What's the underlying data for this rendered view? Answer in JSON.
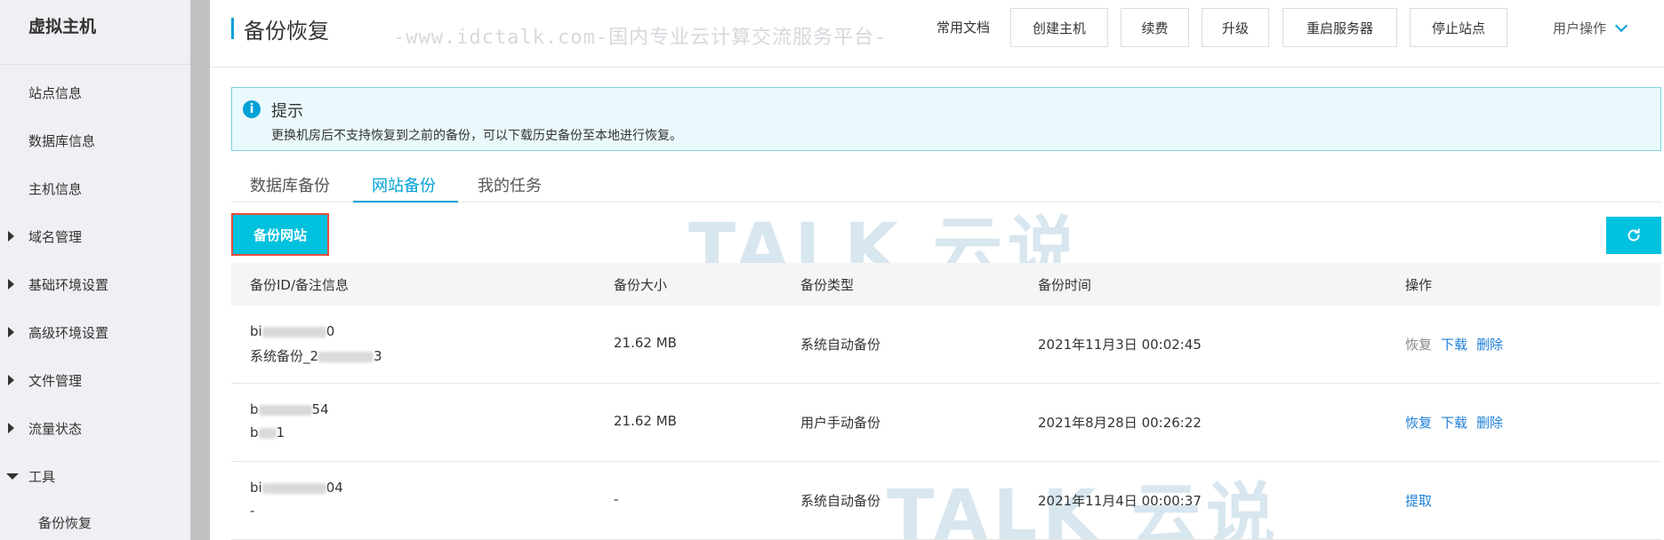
{
  "sidebar": {
    "title": "虚拟主机",
    "items": [
      {
        "label": "站点信息",
        "arrow": ""
      },
      {
        "label": "数据库信息",
        "arrow": ""
      },
      {
        "label": "主机信息",
        "arrow": ""
      },
      {
        "label": "域名管理",
        "arrow": "right"
      },
      {
        "label": "基础环境设置",
        "arrow": "right"
      },
      {
        "label": "高级环境设置",
        "arrow": "right"
      },
      {
        "label": "文件管理",
        "arrow": "right"
      },
      {
        "label": "流量状态",
        "arrow": "right"
      },
      {
        "label": "工具",
        "arrow": "down"
      },
      {
        "label": "备份恢复",
        "arrow": "",
        "sub": true
      }
    ]
  },
  "header": {
    "title": "备份恢复",
    "doc_link": "常用文档",
    "buttons": [
      "创建主机",
      "续费",
      "升级",
      "重启服务器",
      "停止站点"
    ],
    "user_ops": "用户操作"
  },
  "watermark": {
    "text": "-www.idctalk.com-国内专业云计算交流服务平台-",
    "logo": "TALK 云说"
  },
  "notice": {
    "title": "提示",
    "text": "更换机房后不支持恢复到之前的备份，可以下载历史备份至本地进行恢复。"
  },
  "tabs": [
    {
      "label": "数据库备份",
      "active": false
    },
    {
      "label": "网站备份",
      "active": true
    },
    {
      "label": "我的任务",
      "active": false
    }
  ],
  "actions": {
    "backup_site": "备份网站",
    "refresh_icon": "refresh-icon"
  },
  "table": {
    "headers": [
      "备份ID/备注信息",
      "备份大小",
      "备份类型",
      "备份时间",
      "操作"
    ],
    "rows": [
      {
        "id_prefix": "bi",
        "id_suffix": "0",
        "note_prefix": "系统备份_2",
        "note_suffix": "3",
        "size": "21.62 MB",
        "type": "系统自动备份",
        "time": "2021年11月3日 00:02:45",
        "ops": [
          {
            "label": "恢复",
            "enabled": false
          },
          {
            "label": "下载",
            "enabled": true
          },
          {
            "label": "删除",
            "enabled": true
          }
        ]
      },
      {
        "id_prefix": "b",
        "id_suffix": "54",
        "note_prefix": "b",
        "note_suffix": "1",
        "size": "21.62 MB",
        "type": "用户手动备份",
        "time": "2021年8月28日 00:26:22",
        "ops": [
          {
            "label": "恢复",
            "enabled": true
          },
          {
            "label": "下载",
            "enabled": true
          },
          {
            "label": "删除",
            "enabled": true
          }
        ]
      },
      {
        "id_prefix": "bi",
        "id_suffix": "04",
        "note_prefix": "-",
        "note_suffix": "",
        "size": "-",
        "type": "系统自动备份",
        "time": "2021年11月4日 00:00:37",
        "ops": [
          {
            "label": "提取",
            "enabled": true
          }
        ]
      }
    ]
  }
}
